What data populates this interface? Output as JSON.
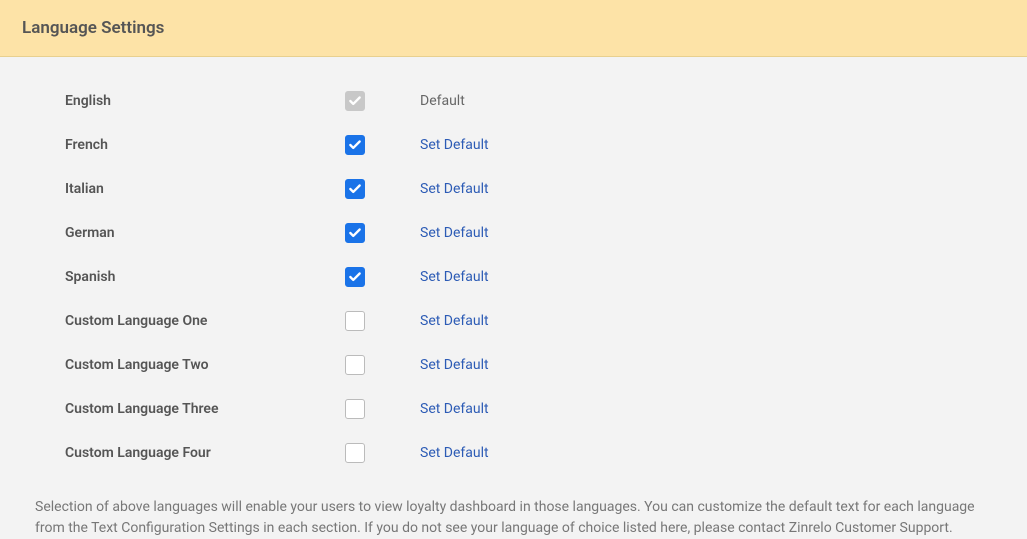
{
  "header": {
    "title": "Language Settings"
  },
  "languages": [
    {
      "name": "English",
      "checked": true,
      "disabled": true,
      "is_default": true
    },
    {
      "name": "French",
      "checked": true,
      "disabled": false,
      "is_default": false
    },
    {
      "name": "Italian",
      "checked": true,
      "disabled": false,
      "is_default": false
    },
    {
      "name": "German",
      "checked": true,
      "disabled": false,
      "is_default": false
    },
    {
      "name": "Spanish",
      "checked": true,
      "disabled": false,
      "is_default": false
    },
    {
      "name": "Custom Language One",
      "checked": false,
      "disabled": false,
      "is_default": false
    },
    {
      "name": "Custom Language Two",
      "checked": false,
      "disabled": false,
      "is_default": false
    },
    {
      "name": "Custom Language Three",
      "checked": false,
      "disabled": false,
      "is_default": false
    },
    {
      "name": "Custom Language Four",
      "checked": false,
      "disabled": false,
      "is_default": false
    }
  ],
  "labels": {
    "default": "Default",
    "set_default": "Set Default"
  },
  "footer": {
    "text": "Selection of above languages will enable your users to view loyalty dashboard in those languages. You can customize the default text for each language from the Text Configuration Settings in each section. If you do not see your language of choice listed here, please contact Zinrelo Customer Support."
  }
}
